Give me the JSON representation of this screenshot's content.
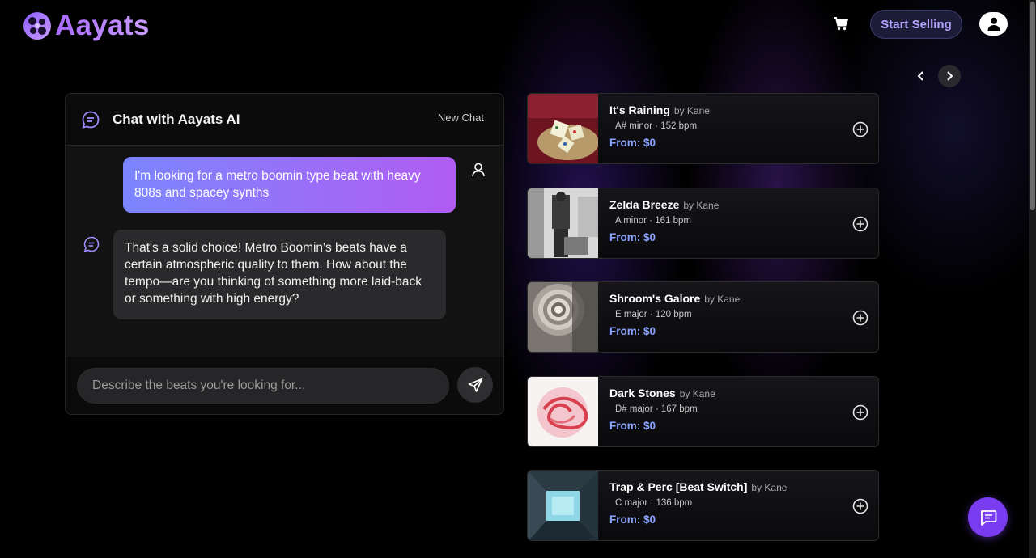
{
  "brand": {
    "name": "Aayats",
    "accent": "#a96bff"
  },
  "header": {
    "start_selling_label": "Start Selling",
    "cart_icon": "cart-icon",
    "account_icon": "user-icon"
  },
  "carousel": {
    "prev_icon": "chevron-left-icon",
    "next_icon": "chevron-right-icon"
  },
  "chat": {
    "title": "Chat with Aayats AI",
    "new_chat_label": "New Chat",
    "messages": [
      {
        "role": "user",
        "text": "I'm looking for a metro boomin type beat with heavy 808s and spacey synths"
      },
      {
        "role": "assistant",
        "text": "That's a solid choice! Metro Boomin's beats have a certain atmospheric quality to them. How about the tempo—are you thinking of something more laid-back or something with high energy?"
      }
    ],
    "input_placeholder": "Describe the beats you're looking for...",
    "send_icon": "send-icon"
  },
  "beats": [
    {
      "title": "It's Raining",
      "artist": "by Kane",
      "key": "A# minor",
      "bpm": "152 bpm",
      "price": "From: $0"
    },
    {
      "title": "Zelda Breeze",
      "artist": "by Kane",
      "key": "A minor",
      "bpm": "161 bpm",
      "price": "From: $0"
    },
    {
      "title": "Shroom's Galore",
      "artist": "by Kane",
      "key": "E major",
      "bpm": "120 bpm",
      "price": "From: $0"
    },
    {
      "title": "Dark Stones",
      "artist": "by Kane",
      "key": "D# major",
      "bpm": "167 bpm",
      "price": "From: $0"
    },
    {
      "title": "Trap & Perc [Beat Switch]",
      "artist": "by Kane",
      "key": "C major",
      "bpm": "136 bpm",
      "price": "From: $0"
    }
  ],
  "floating_chat_icon": "chat-bubble-icon"
}
